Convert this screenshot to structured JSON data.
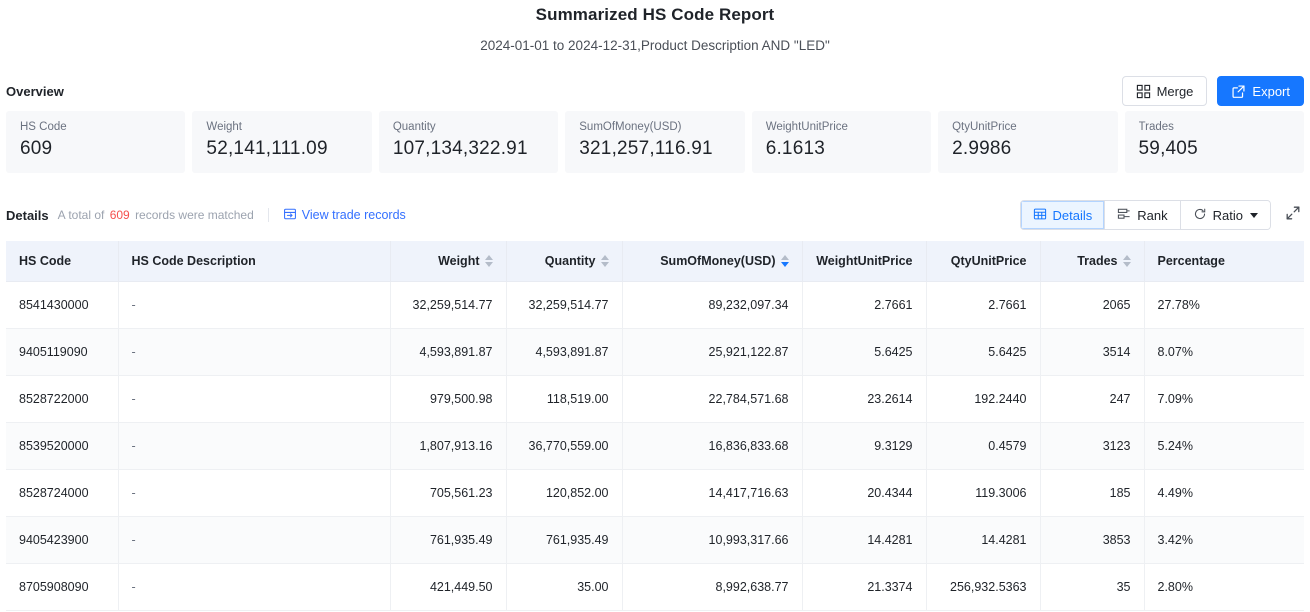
{
  "report": {
    "title": "Summarized HS Code Report",
    "subtitle": "2024-01-01 to 2024-12-31,Product Description AND \"LED\""
  },
  "overview": {
    "label": "Overview",
    "merge_label": "Merge",
    "export_label": "Export",
    "cards": [
      {
        "label": "HS Code",
        "value": "609"
      },
      {
        "label": "Weight",
        "value": "52,141,111.09"
      },
      {
        "label": "Quantity",
        "value": "107,134,322.91"
      },
      {
        "label": "SumOfMoney(USD)",
        "value": "321,257,116.91"
      },
      {
        "label": "WeightUnitPrice",
        "value": "6.1613"
      },
      {
        "label": "QtyUnitPrice",
        "value": "2.9986"
      },
      {
        "label": "Trades",
        "value": "59,405"
      }
    ]
  },
  "details": {
    "title": "Details",
    "note_prefix": "A total of",
    "count": "609",
    "note_suffix": "records were matched",
    "view_trade_records": "View trade records",
    "view_mode_details": "Details",
    "view_mode_rank": "Rank",
    "view_mode_ratio": "Ratio"
  },
  "table": {
    "columns": [
      {
        "key": "hs_code",
        "label": "HS Code",
        "align": "left",
        "sortable": false,
        "sorted": ""
      },
      {
        "key": "description",
        "label": "HS Code Description",
        "align": "left",
        "sortable": false,
        "sorted": ""
      },
      {
        "key": "weight",
        "label": "Weight",
        "align": "right",
        "sortable": true,
        "sorted": ""
      },
      {
        "key": "quantity",
        "label": "Quantity",
        "align": "right",
        "sortable": true,
        "sorted": ""
      },
      {
        "key": "sum_money",
        "label": "SumOfMoney(USD)",
        "align": "right",
        "sortable": true,
        "sorted": "desc"
      },
      {
        "key": "wt_unit",
        "label": "WeightUnitPrice",
        "align": "right",
        "sortable": false,
        "sorted": ""
      },
      {
        "key": "qty_unit",
        "label": "QtyUnitPrice",
        "align": "right",
        "sortable": false,
        "sorted": ""
      },
      {
        "key": "trades",
        "label": "Trades",
        "align": "right",
        "sortable": true,
        "sorted": ""
      },
      {
        "key": "percentage",
        "label": "Percentage",
        "align": "left",
        "sortable": false,
        "sorted": ""
      }
    ],
    "rows": [
      {
        "hs_code": "8541430000",
        "description": "-",
        "weight": "32,259,514.77",
        "quantity": "32,259,514.77",
        "sum_money": "89,232,097.34",
        "wt_unit": "2.7661",
        "qty_unit": "2.7661",
        "trades": "2065",
        "percentage": "27.78%"
      },
      {
        "hs_code": "9405119090",
        "description": "-",
        "weight": "4,593,891.87",
        "quantity": "4,593,891.87",
        "sum_money": "25,921,122.87",
        "wt_unit": "5.6425",
        "qty_unit": "5.6425",
        "trades": "3514",
        "percentage": "8.07%"
      },
      {
        "hs_code": "8528722000",
        "description": "-",
        "weight": "979,500.98",
        "quantity": "118,519.00",
        "sum_money": "22,784,571.68",
        "wt_unit": "23.2614",
        "qty_unit": "192.2440",
        "trades": "247",
        "percentage": "7.09%"
      },
      {
        "hs_code": "8539520000",
        "description": "-",
        "weight": "1,807,913.16",
        "quantity": "36,770,559.00",
        "sum_money": "16,836,833.68",
        "wt_unit": "9.3129",
        "qty_unit": "0.4579",
        "trades": "3123",
        "percentage": "5.24%"
      },
      {
        "hs_code": "8528724000",
        "description": "-",
        "weight": "705,561.23",
        "quantity": "120,852.00",
        "sum_money": "14,417,716.63",
        "wt_unit": "20.4344",
        "qty_unit": "119.3006",
        "trades": "185",
        "percentage": "4.49%"
      },
      {
        "hs_code": "9405423900",
        "description": "-",
        "weight": "761,935.49",
        "quantity": "761,935.49",
        "sum_money": "10,993,317.66",
        "wt_unit": "14.4281",
        "qty_unit": "14.4281",
        "trades": "3853",
        "percentage": "3.42%"
      },
      {
        "hs_code": "8705908090",
        "description": "-",
        "weight": "421,449.50",
        "quantity": "35.00",
        "sum_money": "8,992,638.77",
        "wt_unit": "21.3374",
        "qty_unit": "256,932.5363",
        "trades": "35",
        "percentage": "2.80%"
      }
    ]
  },
  "colors": {
    "accent": "#1677ff",
    "link": "#3470ff",
    "count": "#f5504e",
    "header_bg": "#eff3fb",
    "card_bg": "#f7f8fa"
  }
}
